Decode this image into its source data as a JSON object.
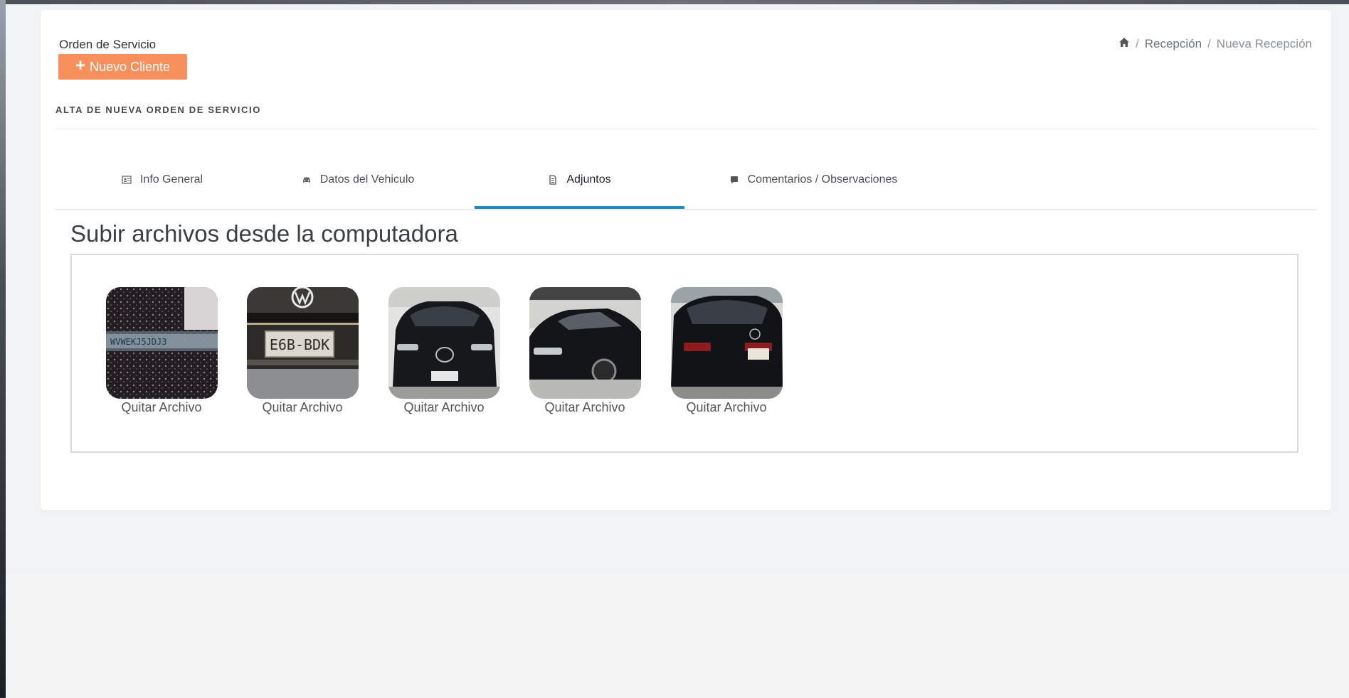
{
  "header": {
    "title": "Orden de Servicio",
    "new_client_label": "Nuevo Cliente"
  },
  "breadcrumb": {
    "items": [
      "Recepción",
      "Nueva Recepción"
    ]
  },
  "section_title": "ALTA DE NUEVA ORDEN DE SERVICIO",
  "tabs": [
    {
      "label": "Info General",
      "icon": "id-card-icon"
    },
    {
      "label": "Datos del Vehiculo",
      "icon": "car-icon"
    },
    {
      "label": "Adjuntos",
      "icon": "file-icon",
      "active": true
    },
    {
      "label": "Comentarios / Observaciones",
      "icon": "comment-icon"
    }
  ],
  "upload": {
    "title": "Subir archivos desde la computadora",
    "files": [
      {
        "remove_label": "Quitar Archivo",
        "plate_text": "WVWEKJ5JDJ3"
      },
      {
        "remove_label": "Quitar Archivo",
        "plate_text": "E6B-BDK"
      },
      {
        "remove_label": "Quitar Archivo"
      },
      {
        "remove_label": "Quitar Archivo"
      },
      {
        "remove_label": "Quitar Archivo"
      }
    ]
  },
  "colors": {
    "accent_button": "#f7905c",
    "active_tab": "#1e8bc3"
  }
}
